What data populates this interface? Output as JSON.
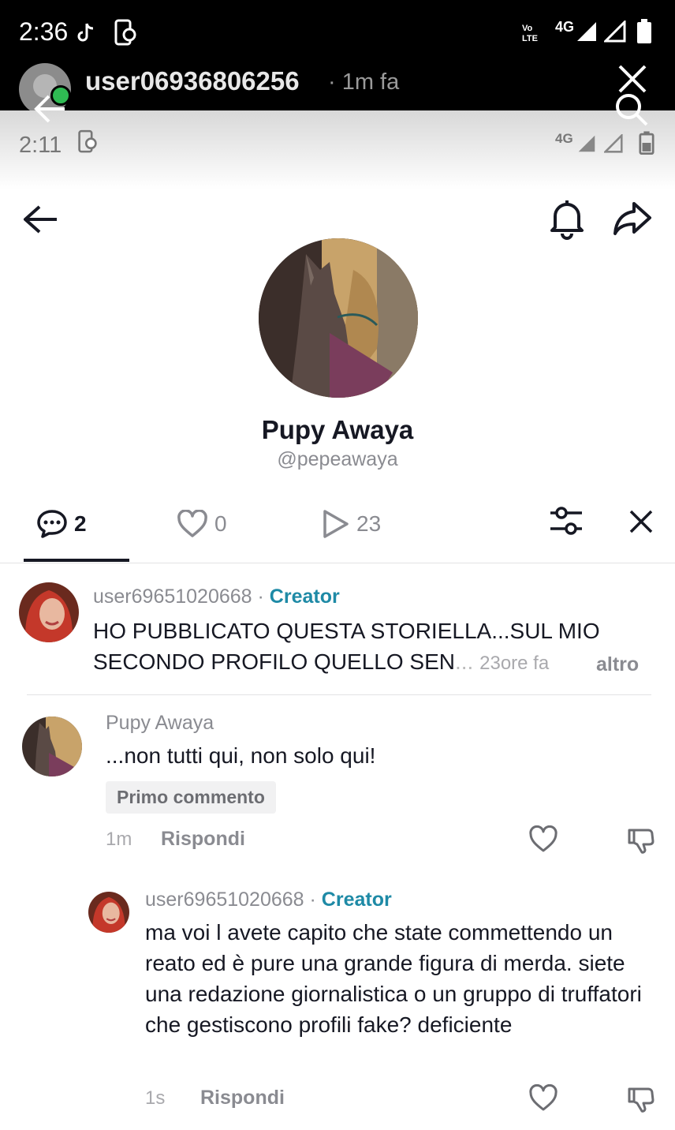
{
  "status_outer": {
    "time": "2:36",
    "network": "4G"
  },
  "notification": {
    "username": "user06936806256",
    "when": "· 1m fa"
  },
  "status_inner": {
    "time": "2:11",
    "network": "4G"
  },
  "profile": {
    "display_name": "Pupy Awaya",
    "handle": "@pepeawaya"
  },
  "tabs": [
    {
      "icon": "comment-icon",
      "count": "2"
    },
    {
      "icon": "heart-icon",
      "count": "0"
    },
    {
      "icon": "play-icon",
      "count": "23"
    }
  ],
  "pinned_comment": {
    "author": "user69651020668",
    "sep": " · ",
    "role": "Creator",
    "text_line1": "HO PUBBLICATO QUESTA STORIELLA...SUL MIO",
    "text_line2": "SECONDO PROFILO QUELLO SEN",
    "ellipsis": "...",
    "time": "23ore fa",
    "more": "altro"
  },
  "comment": {
    "author": "Pupy Awaya",
    "text": "...non tutti qui, non solo qui!",
    "badge": "Primo commento",
    "time": "1m",
    "reply": "Rispondi"
  },
  "reply": {
    "author": "user69651020668",
    "sep": " · ",
    "role": "Creator",
    "text": "ma voi l avete capito che state commettendo un reato ed è pure una grande figura di merda. siete una redazione giornalistica o un gruppo di truffatori che gestiscono profili fake? deficiente",
    "time": "1s",
    "reply": "Rispondi"
  },
  "colors": {
    "accent": "#1e8aa6",
    "online": "#2fba53"
  }
}
